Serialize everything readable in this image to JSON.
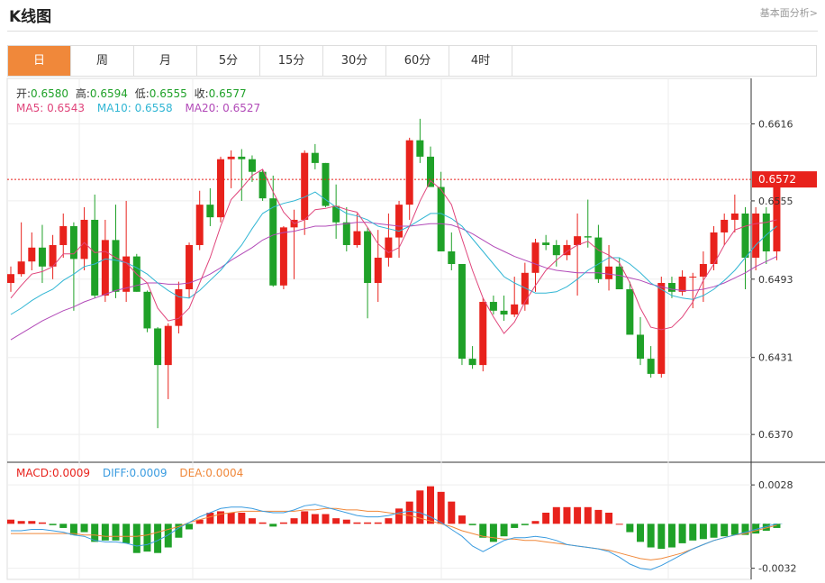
{
  "header": {
    "title": "K线图",
    "link": "基本面分析>"
  },
  "tabs": [
    "日",
    "周",
    "月",
    "5分",
    "15分",
    "30分",
    "60分",
    "4时"
  ],
  "active_tab": 0,
  "ohlc": {
    "open_label": "开:",
    "open": "0.6580",
    "high_label": "高:",
    "high": "0.6594",
    "low_label": "低:",
    "low": "0.6555",
    "close_label": "收:",
    "close": "0.6577"
  },
  "ma": {
    "ma5_label": "MA5:",
    "ma5": "0.6543",
    "ma10_label": "MA10:",
    "ma10": "0.6558",
    "ma20_label": "MA20:",
    "ma20": "0.6527"
  },
  "macd": {
    "macd_label": "MACD:",
    "macd": "0.0009",
    "diff_label": "DIFF:",
    "diff": "0.0009",
    "dea_label": "DEA:",
    "dea": "0.0004"
  },
  "current_price": "0.6572",
  "current_price_value": 0.6572,
  "colors": {
    "up": "#e8221c",
    "down": "#1fa128",
    "ma5": "#e0457b",
    "ma10": "#31b6d4",
    "ma20": "#b24ab8",
    "diff": "#3a9ce0",
    "dea": "#f0883a",
    "accent": "#f0883a"
  },
  "chart_data": {
    "type": "candlestick",
    "price_axis": {
      "ticks": [
        "0.6616",
        "0.6555",
        "0.6493",
        "0.6431",
        "0.6370"
      ],
      "tick_values": [
        0.6616,
        0.6555,
        0.6493,
        0.6431,
        0.637
      ],
      "range": [
        0.6348,
        0.6652
      ]
    },
    "macd_axis": {
      "ticks": [
        "0.0028",
        "-0.0032"
      ],
      "tick_values": [
        0.0028,
        -0.0032
      ],
      "range": [
        -0.004,
        0.0043
      ]
    },
    "candles": [
      [
        0.649,
        0.6503,
        0.6483,
        0.6497
      ],
      [
        0.6497,
        0.6538,
        0.6495,
        0.6507
      ],
      [
        0.6507,
        0.653,
        0.65,
        0.6518
      ],
      [
        0.6518,
        0.6536,
        0.649,
        0.6503
      ],
      [
        0.6503,
        0.6528,
        0.6493,
        0.652
      ],
      [
        0.652,
        0.6545,
        0.651,
        0.6535
      ],
      [
        0.6535,
        0.6538,
        0.6468,
        0.6509
      ],
      [
        0.6509,
        0.655,
        0.65,
        0.654
      ],
      [
        0.654,
        0.656,
        0.6478,
        0.648
      ],
      [
        0.648,
        0.654,
        0.6475,
        0.6524
      ],
      [
        0.6524,
        0.6552,
        0.6478,
        0.6483
      ],
      [
        0.6483,
        0.6555,
        0.6475,
        0.6511
      ],
      [
        0.6511,
        0.6513,
        0.6483,
        0.6483
      ],
      [
        0.6483,
        0.6484,
        0.6451,
        0.6454
      ],
      [
        0.6454,
        0.6455,
        0.6375,
        0.6425
      ],
      [
        0.6425,
        0.6458,
        0.6398,
        0.6456
      ],
      [
        0.6456,
        0.6491,
        0.645,
        0.6485
      ],
      [
        0.6485,
        0.6522,
        0.6478,
        0.652
      ],
      [
        0.652,
        0.6563,
        0.6516,
        0.6552
      ],
      [
        0.6552,
        0.6565,
        0.6535,
        0.6542
      ],
      [
        0.6542,
        0.659,
        0.6538,
        0.6588
      ],
      [
        0.6588,
        0.6595,
        0.6565,
        0.659
      ],
      [
        0.659,
        0.6596,
        0.6555,
        0.6588
      ],
      [
        0.6588,
        0.6591,
        0.657,
        0.6578
      ],
      [
        0.6578,
        0.658,
        0.6555,
        0.6557
      ],
      [
        0.6557,
        0.6575,
        0.6487,
        0.6488
      ],
      [
        0.6488,
        0.6535,
        0.6485,
        0.6534
      ],
      [
        0.6534,
        0.6548,
        0.6493,
        0.654
      ],
      [
        0.654,
        0.6595,
        0.6528,
        0.6593
      ],
      [
        0.6593,
        0.66,
        0.658,
        0.6585
      ],
      [
        0.6585,
        0.6585,
        0.655,
        0.6551
      ],
      [
        0.6551,
        0.6568,
        0.6525,
        0.6538
      ],
      [
        0.6538,
        0.655,
        0.6515,
        0.652
      ],
      [
        0.652,
        0.6545,
        0.6518,
        0.6531
      ],
      [
        0.6531,
        0.6534,
        0.6462,
        0.649
      ],
      [
        0.649,
        0.6532,
        0.6475,
        0.651
      ],
      [
        0.651,
        0.6545,
        0.6503,
        0.6526
      ],
      [
        0.6526,
        0.6555,
        0.651,
        0.6552
      ],
      [
        0.6552,
        0.6605,
        0.654,
        0.6603
      ],
      [
        0.6603,
        0.662,
        0.6585,
        0.659
      ],
      [
        0.659,
        0.6598,
        0.657,
        0.6566
      ],
      [
        0.6566,
        0.6578,
        0.6515,
        0.6515
      ],
      [
        0.6515,
        0.653,
        0.65,
        0.6505
      ],
      [
        0.6505,
        0.6505,
        0.6425,
        0.643
      ],
      [
        0.643,
        0.644,
        0.6422,
        0.6425
      ],
      [
        0.6425,
        0.6478,
        0.642,
        0.6475
      ],
      [
        0.6475,
        0.648,
        0.6465,
        0.6468
      ],
      [
        0.6468,
        0.648,
        0.646,
        0.6465
      ],
      [
        0.6465,
        0.6495,
        0.6463,
        0.6473
      ],
      [
        0.6473,
        0.6506,
        0.6468,
        0.6498
      ],
      [
        0.6498,
        0.6525,
        0.6483,
        0.6522
      ],
      [
        0.6522,
        0.6528,
        0.6516,
        0.652
      ],
      [
        0.652,
        0.6524,
        0.6503,
        0.6512
      ],
      [
        0.6512,
        0.6524,
        0.6508,
        0.652
      ],
      [
        0.652,
        0.6545,
        0.648,
        0.6527
      ],
      [
        0.6527,
        0.6556,
        0.6518,
        0.6526
      ],
      [
        0.6526,
        0.6536,
        0.649,
        0.6493
      ],
      [
        0.6493,
        0.652,
        0.6484,
        0.6503
      ],
      [
        0.6503,
        0.651,
        0.6488,
        0.6485
      ],
      [
        0.6485,
        0.6491,
        0.645,
        0.6449
      ],
      [
        0.6449,
        0.6463,
        0.6425,
        0.643
      ],
      [
        0.643,
        0.644,
        0.6415,
        0.6418
      ],
      [
        0.6418,
        0.6495,
        0.6415,
        0.649
      ],
      [
        0.649,
        0.6495,
        0.6478,
        0.6483
      ],
      [
        0.6483,
        0.65,
        0.648,
        0.6495
      ],
      [
        0.6495,
        0.6498,
        0.647,
        0.6495
      ],
      [
        0.6495,
        0.6515,
        0.6475,
        0.6505
      ],
      [
        0.6505,
        0.6535,
        0.65,
        0.653
      ],
      [
        0.653,
        0.6545,
        0.652,
        0.654
      ],
      [
        0.654,
        0.656,
        0.653,
        0.6545
      ],
      [
        0.6545,
        0.655,
        0.6485,
        0.651
      ],
      [
        0.651,
        0.655,
        0.65,
        0.6545
      ],
      [
        0.6545,
        0.655,
        0.6505,
        0.6515
      ],
      [
        0.6515,
        0.6572,
        0.6508,
        0.657
      ]
    ],
    "ma5": [
      0.6478,
      0.6488,
      0.6497,
      0.6499,
      0.6503,
      0.6513,
      0.6513,
      0.6522,
      0.6514,
      0.6515,
      0.651,
      0.6506,
      0.6497,
      0.649,
      0.647,
      0.646,
      0.6462,
      0.647,
      0.649,
      0.651,
      0.6535,
      0.6556,
      0.6565,
      0.6575,
      0.658,
      0.6562,
      0.6546,
      0.6537,
      0.654,
      0.6548,
      0.6549,
      0.6551,
      0.6548,
      0.6546,
      0.6534,
      0.6521,
      0.6514,
      0.6518,
      0.6535,
      0.6555,
      0.6571,
      0.6564,
      0.6552,
      0.6525,
      0.65,
      0.6478,
      0.6463,
      0.645,
      0.6459,
      0.6475,
      0.6488,
      0.65,
      0.6508,
      0.6515,
      0.652,
      0.6523,
      0.6516,
      0.6512,
      0.6506,
      0.649,
      0.647,
      0.6455,
      0.6453,
      0.6455,
      0.6463,
      0.6475,
      0.6492,
      0.6505,
      0.652,
      0.6532,
      0.6535,
      0.6537,
      0.6538,
      0.654
    ],
    "ma10": [
      0.6465,
      0.647,
      0.6476,
      0.6481,
      0.6485,
      0.6492,
      0.6497,
      0.6503,
      0.6505,
      0.6509,
      0.6508,
      0.6506,
      0.6502,
      0.6497,
      0.649,
      0.6484,
      0.6479,
      0.6478,
      0.6484,
      0.6492,
      0.65,
      0.651,
      0.652,
      0.6533,
      0.6545,
      0.655,
      0.6553,
      0.6555,
      0.6558,
      0.6562,
      0.6556,
      0.655,
      0.6545,
      0.6543,
      0.654,
      0.6535,
      0.6533,
      0.6531,
      0.6535,
      0.654,
      0.6545,
      0.6545,
      0.6541,
      0.6535,
      0.6525,
      0.6515,
      0.6505,
      0.6495,
      0.649,
      0.6486,
      0.6482,
      0.6482,
      0.6483,
      0.6487,
      0.6493,
      0.65,
      0.6505,
      0.651,
      0.651,
      0.6505,
      0.6498,
      0.649,
      0.6485,
      0.648,
      0.6478,
      0.6477,
      0.648,
      0.6485,
      0.6492,
      0.65,
      0.651,
      0.652,
      0.6528,
      0.6535
    ],
    "ma20": [
      0.6445,
      0.645,
      0.6455,
      0.646,
      0.6464,
      0.6468,
      0.6471,
      0.6475,
      0.6478,
      0.6481,
      0.6484,
      0.6486,
      0.6488,
      0.649,
      0.649,
      0.6489,
      0.6489,
      0.649,
      0.6493,
      0.6497,
      0.6502,
      0.6508,
      0.6513,
      0.6518,
      0.6524,
      0.6528,
      0.653,
      0.6531,
      0.6533,
      0.6535,
      0.6535,
      0.6536,
      0.6537,
      0.6538,
      0.6538,
      0.6537,
      0.6536,
      0.6535,
      0.6535,
      0.6536,
      0.6537,
      0.6537,
      0.6536,
      0.6533,
      0.6529,
      0.6524,
      0.6519,
      0.6515,
      0.6511,
      0.6508,
      0.6505,
      0.6502,
      0.65,
      0.6499,
      0.6498,
      0.6498,
      0.6498,
      0.6497,
      0.6496,
      0.6494,
      0.6492,
      0.6489,
      0.6487,
      0.6485,
      0.6484,
      0.6484,
      0.6485,
      0.6487,
      0.649,
      0.6494,
      0.6498,
      0.6503,
      0.6507,
      0.6511
    ],
    "macd_hist": [
      0.0003,
      0.0002,
      0.0002,
      0.0001,
      -0.0001,
      -0.0003,
      -0.0008,
      -0.0006,
      -0.0013,
      -0.0012,
      -0.0012,
      -0.0014,
      -0.0021,
      -0.002,
      -0.0021,
      -0.0017,
      -0.001,
      -0.0004,
      0.0003,
      0.0008,
      0.0009,
      0.0008,
      0.0008,
      0.0004,
      0.0001,
      -0.0002,
      0.0001,
      0.0004,
      0.0009,
      0.0007,
      0.0007,
      0.0004,
      0.0003,
      0.0001,
      0.0001,
      0.0001,
      0.0004,
      0.0011,
      0.0016,
      0.0024,
      0.0027,
      0.0023,
      0.0016,
      0.0006,
      -0.0001,
      -0.001,
      -0.0013,
      -0.0009,
      -0.0003,
      -0.0001,
      0.0002,
      0.0008,
      0.0012,
      0.0012,
      0.0012,
      0.0012,
      0.001,
      0.0008,
      0.0,
      -0.0006,
      -0.0013,
      -0.0017,
      -0.0018,
      -0.0017,
      -0.0014,
      -0.0012,
      -0.0011,
      -0.001,
      -0.0009,
      -0.0008,
      -0.0008,
      -0.0007,
      -0.0005,
      -0.0003
    ],
    "diff": [
      -0.0005,
      -0.0005,
      -0.0004,
      -0.0004,
      -0.0005,
      -0.0006,
      -0.0008,
      -0.0009,
      -0.0012,
      -0.0013,
      -0.0013,
      -0.0014,
      -0.0016,
      -0.0015,
      -0.0012,
      -0.0008,
      -0.0003,
      0.0001,
      0.0005,
      0.0008,
      0.0011,
      0.0012,
      0.0012,
      0.0011,
      0.0009,
      0.0008,
      0.0008,
      0.001,
      0.0013,
      0.0014,
      0.0012,
      0.001,
      0.0008,
      0.0006,
      0.0005,
      0.0005,
      0.0006,
      0.0008,
      0.0009,
      0.0008,
      0.0005,
      0.0001,
      -0.0004,
      -0.0009,
      -0.0016,
      -0.002,
      -0.0016,
      -0.0012,
      -0.001,
      -0.001,
      -0.0009,
      -0.001,
      -0.0012,
      -0.0015,
      -0.0016,
      -0.0017,
      -0.0018,
      -0.002,
      -0.0024,
      -0.0029,
      -0.0032,
      -0.0033,
      -0.003,
      -0.0026,
      -0.0022,
      -0.0018,
      -0.0015,
      -0.0012,
      -0.001,
      -0.0008,
      -0.0006,
      -0.0004,
      -0.0002,
      0.0
    ],
    "dea": [
      -0.0007,
      -0.0007,
      -0.0007,
      -0.0007,
      -0.0007,
      -0.0007,
      -0.0007,
      -0.0008,
      -0.0008,
      -0.0009,
      -0.0009,
      -0.0009,
      -0.0009,
      -0.0008,
      -0.0006,
      -0.0004,
      -0.0002,
      0.0001,
      0.0003,
      0.0005,
      0.0007,
      0.0008,
      0.0009,
      0.0009,
      0.0009,
      0.0009,
      0.0009,
      0.0009,
      0.001,
      0.001,
      0.0011,
      0.0011,
      0.001,
      0.001,
      0.0009,
      0.0009,
      0.0008,
      0.0007,
      0.0006,
      0.0004,
      0.0002,
      0.0,
      -0.0002,
      -0.0005,
      -0.0007,
      -0.0009,
      -0.001,
      -0.0011,
      -0.0011,
      -0.0012,
      -0.0012,
      -0.0013,
      -0.0014,
      -0.0015,
      -0.0016,
      -0.0017,
      -0.0018,
      -0.0019,
      -0.0021,
      -0.0023,
      -0.0025,
      -0.0026,
      -0.0025,
      -0.0023,
      -0.0021,
      -0.0018,
      -0.0015,
      -0.0012,
      -0.001,
      -0.0008,
      -0.0007,
      -0.0005,
      -0.0003,
      -0.0001
    ]
  }
}
